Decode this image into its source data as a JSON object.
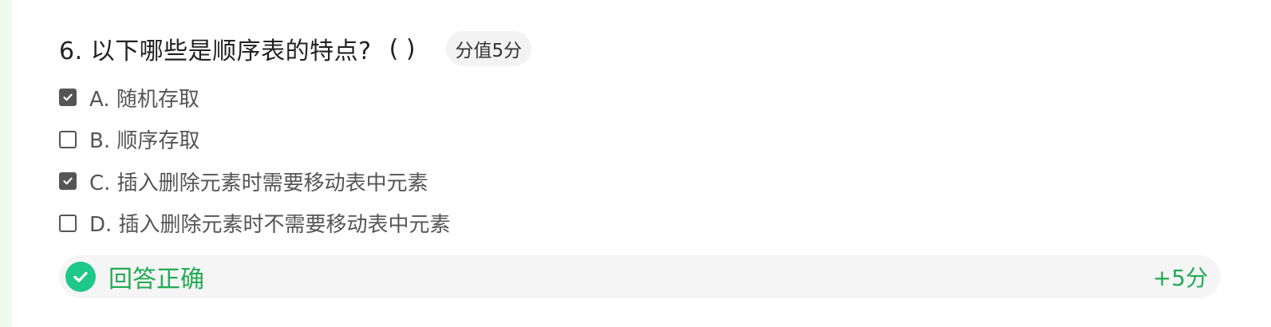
{
  "question": {
    "title": "6. 以下哪些是顺序表的特点?",
    "paren": "( )",
    "score_badge": "分值5分"
  },
  "options": [
    {
      "label": "A. 随机存取",
      "checked": true
    },
    {
      "label": "B. 顺序存取",
      "checked": false
    },
    {
      "label": "C. 插入删除元素时需要移动表中元素",
      "checked": true
    },
    {
      "label": "D. 插入删除元素时不需要移动表中元素",
      "checked": false
    }
  ],
  "result": {
    "text": "回答正确",
    "score": "+5分",
    "icon": "check-circle-icon",
    "color": "#22aa55"
  },
  "colors": {
    "sidebar_accent": "#effaef",
    "checkbox": "#555555",
    "success_icon_bg": "#1fc788"
  }
}
